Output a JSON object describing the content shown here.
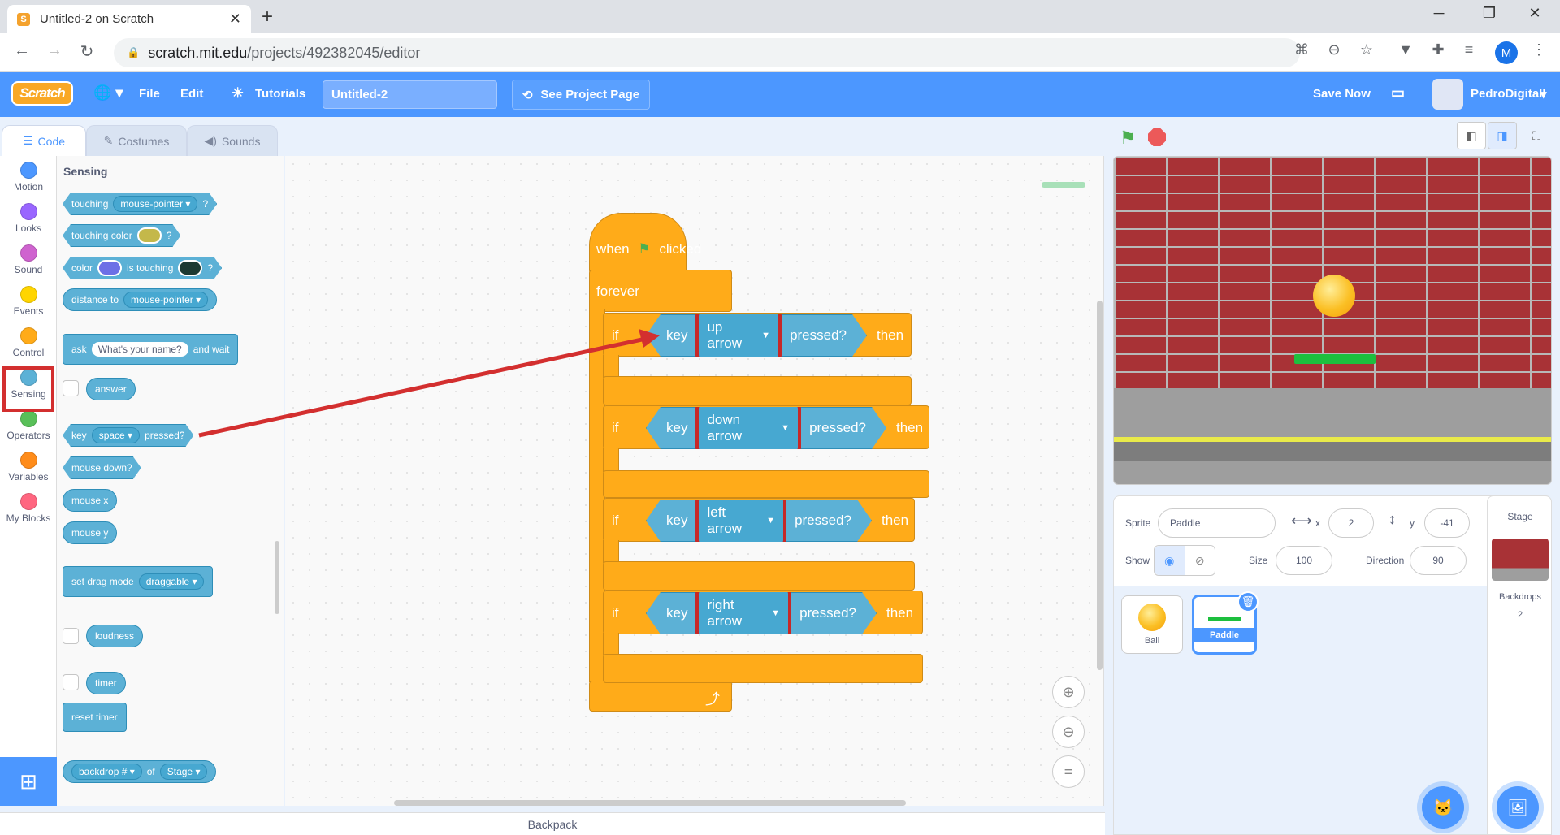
{
  "browser": {
    "tab_title": "Untitled-2 on Scratch",
    "url_host": "scratch.mit.edu",
    "url_path": "/projects/492382045/editor",
    "profile_initial": "M"
  },
  "menubar": {
    "logo": "Scratch",
    "file": "File",
    "edit": "Edit",
    "tutorials": "Tutorials",
    "project_title": "Untitled-2",
    "see_project_page": "See Project Page",
    "save_now": "Save Now",
    "username": "PedroDigitall"
  },
  "editor_tabs": {
    "code": "Code",
    "costumes": "Costumes",
    "sounds": "Sounds"
  },
  "categories": [
    {
      "label": "Motion",
      "color": "#4c97ff"
    },
    {
      "label": "Looks",
      "color": "#9966ff"
    },
    {
      "label": "Sound",
      "color": "#cf63cf"
    },
    {
      "label": "Events",
      "color": "#ffd500"
    },
    {
      "label": "Control",
      "color": "#ffab19"
    },
    {
      "label": "Sensing",
      "color": "#5cb1d6"
    },
    {
      "label": "Operators",
      "color": "#59c059"
    },
    {
      "label": "Variables",
      "color": "#ff8c1a"
    },
    {
      "label": "My Blocks",
      "color": "#ff6680"
    }
  ],
  "palette": {
    "title": "Sensing",
    "touching": "touching",
    "mouse_pointer": "mouse-pointer",
    "question": "?",
    "touching_color": "touching color",
    "color": "color",
    "is_touching": "is touching",
    "distance_to": "distance to",
    "ask": "ask",
    "ask_default": "What's your name?",
    "and_wait": "and wait",
    "answer": "answer",
    "key": "key",
    "space": "space",
    "pressed": "pressed?",
    "mouse_down": "mouse down?",
    "mouse_x": "mouse x",
    "mouse_y": "mouse y",
    "set_drag_mode": "set drag mode",
    "draggable": "draggable",
    "loudness": "loudness",
    "timer": "timer",
    "reset_timer": "reset timer",
    "backdrop_num": "backdrop #",
    "of": "of",
    "stage": "Stage"
  },
  "script": {
    "when": "when",
    "clicked": "clicked",
    "forever": "forever",
    "if": "if",
    "key": "key",
    "pressed": "pressed?",
    "then": "then",
    "keys": [
      "up arrow",
      "down arrow",
      "left arrow",
      "right arrow"
    ]
  },
  "backpack": "Backpack",
  "sprite_info": {
    "sprite_label": "Sprite",
    "sprite_name": "Paddle",
    "x_label": "x",
    "x_value": "2",
    "y_label": "y",
    "y_value": "-41",
    "show_label": "Show",
    "size_label": "Size",
    "size_value": "100",
    "direction_label": "Direction",
    "direction_value": "90"
  },
  "sprites": [
    {
      "name": "Ball",
      "selected": false
    },
    {
      "name": "Paddle",
      "selected": true
    }
  ],
  "stage_panel": {
    "title": "Stage",
    "backdrops_label": "Backdrops",
    "backdrops_count": "2"
  },
  "colors": {
    "scratch_blue": "#4c97ff",
    "control_orange": "#ffab19",
    "sensing_blue": "#5cb1d6",
    "highlight_red": "#d32f2f"
  }
}
